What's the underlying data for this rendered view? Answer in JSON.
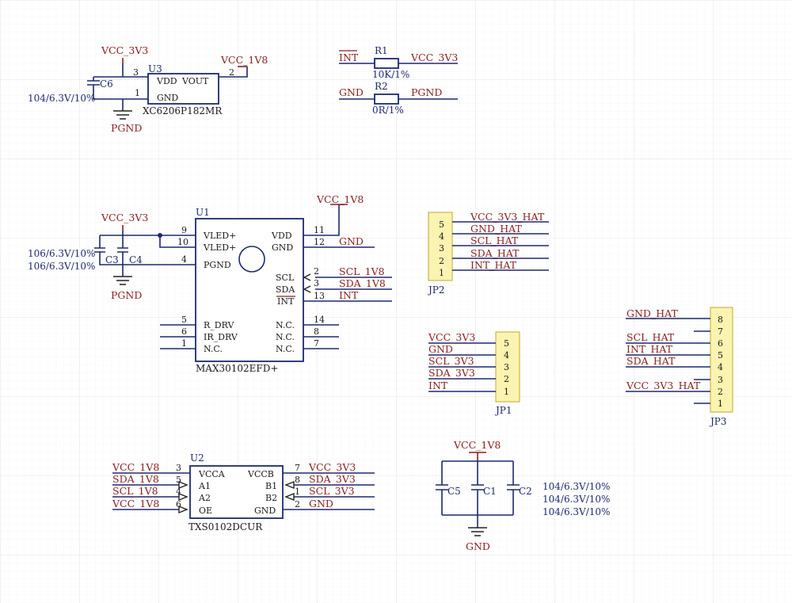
{
  "nets": {
    "vcc3v3": "VCC_3V3",
    "vcc1v8": "VCC_1V8",
    "pgnd": "PGND",
    "gnd": "GND",
    "int": "INT",
    "scl1v8": "SCL_1V8",
    "sda1v8": "SDA_1V8",
    "scl3v3": "SCL_3V3",
    "sda3v3": "SDA_3V3",
    "vcc3v3hat": "VCC_3V3_HAT",
    "gndhat": "GND_HAT",
    "sclhat": "SCL_HAT",
    "sdahat": "SDA_HAT",
    "inthat": "INT_HAT"
  },
  "u3": {
    "ref": "U3",
    "part": "XC6206P182MR",
    "pin_names": [
      "VDD",
      "VOUT",
      "GND"
    ],
    "pin_nums": [
      "3",
      "2",
      "1"
    ]
  },
  "c6": {
    "ref": "C6",
    "value": "104/6.3V/10%"
  },
  "r1": {
    "ref": "R1",
    "value": "10K/1%"
  },
  "r2": {
    "ref": "R2",
    "value": "0R/1%"
  },
  "u1": {
    "ref": "U1",
    "part": "MAX30102EFD+",
    "left_pins": [
      {
        "num": "9",
        "name": "VLED+"
      },
      {
        "num": "10",
        "name": "VLED+"
      },
      {
        "num": "4",
        "name": "PGND"
      },
      {
        "num": "5",
        "name": "R_DRV"
      },
      {
        "num": "6",
        "name": "IR_DRV"
      },
      {
        "num": "1",
        "name": "N.C."
      }
    ],
    "right_pins": [
      {
        "num": "11",
        "name": "VDD"
      },
      {
        "num": "12",
        "name": "GND"
      },
      {
        "num": "2",
        "name": "SCL"
      },
      {
        "num": "3",
        "name": "SDA"
      },
      {
        "num": "13",
        "name": "INT"
      },
      {
        "num": "14",
        "name": "N.C."
      },
      {
        "num": "8",
        "name": "N.C."
      },
      {
        "num": "7",
        "name": "N.C."
      }
    ]
  },
  "c3": {
    "ref": "C3",
    "value": "106/6.3V/10%"
  },
  "c4": {
    "ref": "C4",
    "value": "106/6.3V/10%"
  },
  "jp2": {
    "ref": "JP2",
    "pins": [
      "5",
      "4",
      "3",
      "2",
      "1"
    ]
  },
  "jp1": {
    "ref": "JP1",
    "pins": [
      "5",
      "4",
      "3",
      "2",
      "1"
    ]
  },
  "jp3": {
    "ref": "JP3",
    "pins": [
      "8",
      "7",
      "6",
      "5",
      "4",
      "3",
      "2",
      "1"
    ]
  },
  "u2": {
    "ref": "U2",
    "part": "TXS0102DCUR",
    "left_pins": [
      {
        "num": "3",
        "name": "VCCA"
      },
      {
        "num": "5",
        "name": "A1"
      },
      {
        "num": "4",
        "name": "A2"
      },
      {
        "num": "6",
        "name": "OE"
      }
    ],
    "right_pins": [
      {
        "num": "7",
        "name": "VCCB"
      },
      {
        "num": "8",
        "name": "B1"
      },
      {
        "num": "1",
        "name": "B2"
      },
      {
        "num": "2",
        "name": "GND"
      }
    ]
  },
  "c5": {
    "ref": "C5",
    "value": "104/6.3V/10%"
  },
  "c1": {
    "ref": "C1",
    "value": "104/6.3V/10%"
  },
  "c2": {
    "ref": "C2",
    "value": "104/6.3V/10%"
  },
  "colors": {
    "grid": "#e6e6e6",
    "wire": "#1c2a6e",
    "net_label": "#8b1e1e",
    "header_fill": "#fbf3b0"
  }
}
